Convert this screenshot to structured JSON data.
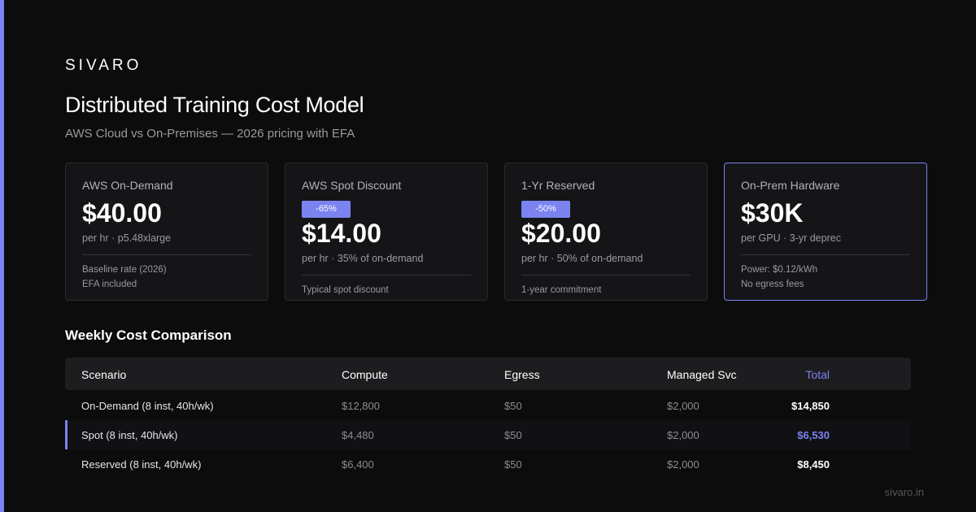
{
  "brand": "SIVARO",
  "title": "Distributed Training Cost Model",
  "subtitle": "AWS Cloud vs On-Premises — 2026 pricing with EFA",
  "colors": {
    "accent": "#7b83f0",
    "background": "#0c0c0d",
    "card": "#151517"
  },
  "cards": [
    {
      "label": "AWS On-Demand",
      "value": "$40.00",
      "unit": "per hr · p5.48xlarge",
      "notes": [
        "Baseline rate (2026)",
        "EFA included"
      ]
    },
    {
      "label": "AWS Spot Discount",
      "badge": "-65%",
      "value": "$14.00",
      "unit": "per hr · 35% of on-demand",
      "notes": [
        "Typical spot discount"
      ]
    },
    {
      "label": "1-Yr Reserved",
      "badge": "-50%",
      "value": "$20.00",
      "unit": "per hr · 50% of on-demand",
      "notes": [
        "1-year commitment"
      ]
    },
    {
      "label": "On-Prem Hardware",
      "value": "$30K",
      "unit": "per GPU · 3-yr deprec",
      "notes": [
        "Power: $0.12/kWh",
        "No egress fees"
      ]
    }
  ],
  "table": {
    "title": "Weekly Cost Comparison",
    "headers": {
      "scenario": "Scenario",
      "compute": "Compute",
      "egress": "Egress",
      "managed": "Managed Svc",
      "total": "Total"
    },
    "rows": [
      {
        "scenario": "On-Demand (8 inst, 40h/wk)",
        "compute": "$12,800",
        "egress": "$50",
        "managed": "$2,000",
        "total": "$14,850"
      },
      {
        "scenario": "Spot (8 inst, 40h/wk)",
        "compute": "$4,480",
        "egress": "$50",
        "managed": "$2,000",
        "total": "$6,530"
      },
      {
        "scenario": "Reserved (8 inst, 40h/wk)",
        "compute": "$6,400",
        "egress": "$50",
        "managed": "$2,000",
        "total": "$8,450"
      }
    ]
  },
  "footer": "sivaro.in"
}
